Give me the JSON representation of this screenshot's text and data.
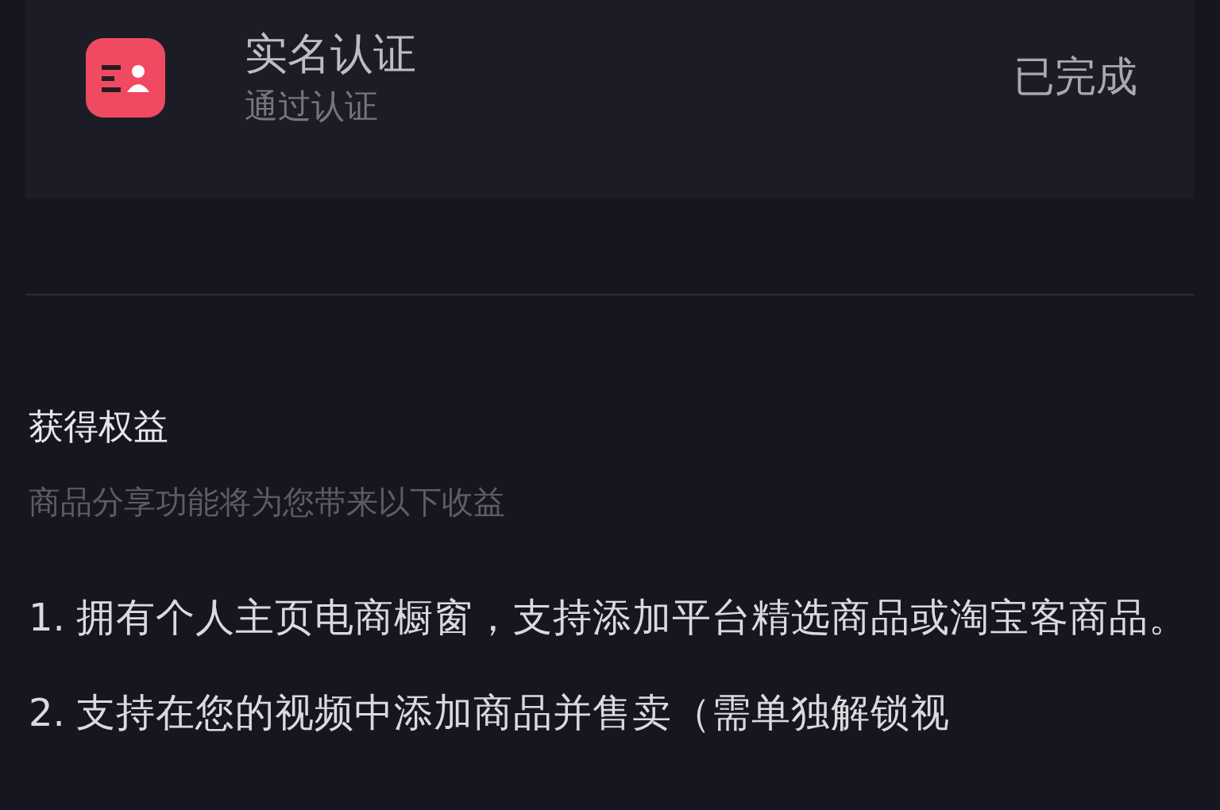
{
  "verification": {
    "title": "实名认证",
    "subtitle": "通过认证",
    "status": "已完成"
  },
  "benefits": {
    "title": "获得权益",
    "subtitle": "商品分享功能将为您带来以下收益",
    "items": [
      {
        "number": "1.",
        "text": "拥有个人主页电商橱窗，支持添加平台精选商品或淘宝客商品。"
      },
      {
        "number": "2.",
        "text": "支持在您的视频中添加商品并售卖（需单独解锁视"
      }
    ]
  }
}
